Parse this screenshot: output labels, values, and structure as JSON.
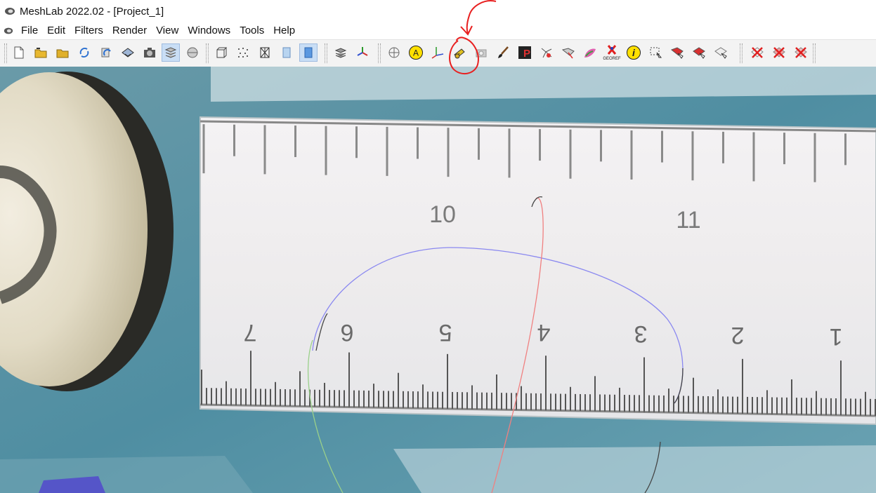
{
  "window": {
    "title": "MeshLab 2022.02 - [Project_1]"
  },
  "menu": {
    "items": [
      "File",
      "Edit",
      "Filters",
      "Render",
      "View",
      "Windows",
      "Tools",
      "Help"
    ]
  },
  "toolbar": {
    "groups": [
      [
        "new-document-icon",
        "open-folder-icon",
        "import-mesh-icon",
        "reload-icon",
        "reload-all-icon",
        "save-icon",
        "snapshot-icon",
        "layers-icon",
        "raster-layers-icon"
      ],
      [
        "box-render-icon",
        "points-render-icon",
        "wireframe-render-icon",
        "flat-shading-icon",
        "smooth-shading-icon"
      ],
      [
        "layer-stack-icon",
        "axes-transform-icon"
      ],
      [
        "sphere-icon",
        "align-a-icon",
        "measure-axes-icon",
        "measure-tool-icon",
        "camera-icon",
        "paint-brush-icon",
        "pickpoints-icon",
        "fill-hole-icon",
        "select-vertices-icon",
        "z-paint-icon",
        "georef-icon",
        "info-icon",
        "select-region-icon",
        "select-faces-icon",
        "select-connected-icon",
        "select-cursor-icon"
      ],
      [
        "delete-vertices-icon",
        "delete-faces-icon",
        "delete-faces-vertices-icon"
      ]
    ],
    "active": [
      "layers-icon",
      "smooth-shading-icon"
    ],
    "georef_label": "GEOREF",
    "align_label": "A",
    "info_label": "i",
    "pick_label": "P"
  },
  "ruler": {
    "upper_numbers": [
      "10",
      "11"
    ],
    "lower_numbers": [
      "7",
      "6",
      "5",
      "4",
      "3",
      "2",
      "1"
    ]
  }
}
